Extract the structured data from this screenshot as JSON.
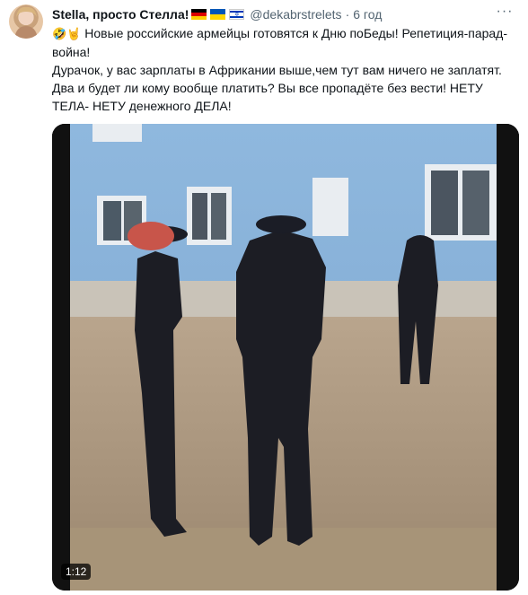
{
  "tweet": {
    "author_name": "Stella, просто Стелла!",
    "flags": [
      "flag-de",
      "flag-ua",
      "flag-il"
    ],
    "handle": "@dekabrstrelets",
    "separator": "·",
    "time": "6 год",
    "more_label": "···",
    "text_line1_emoji": "🤣🤘",
    "text_line1": " Новые российские армейцы готовятся к Дню поБеды! Репетиция-парад- война!",
    "text_line2": "Дурачок, у вас зарплаты в Африкании выше,чем тут вам ничего не заплатят. Два и будет ли кому вообще платить? Вы все пропадёте без вести! НЕТУ ТЕЛА- НЕТУ денежного ДЕЛА!"
  },
  "video": {
    "duration": "1:12"
  }
}
